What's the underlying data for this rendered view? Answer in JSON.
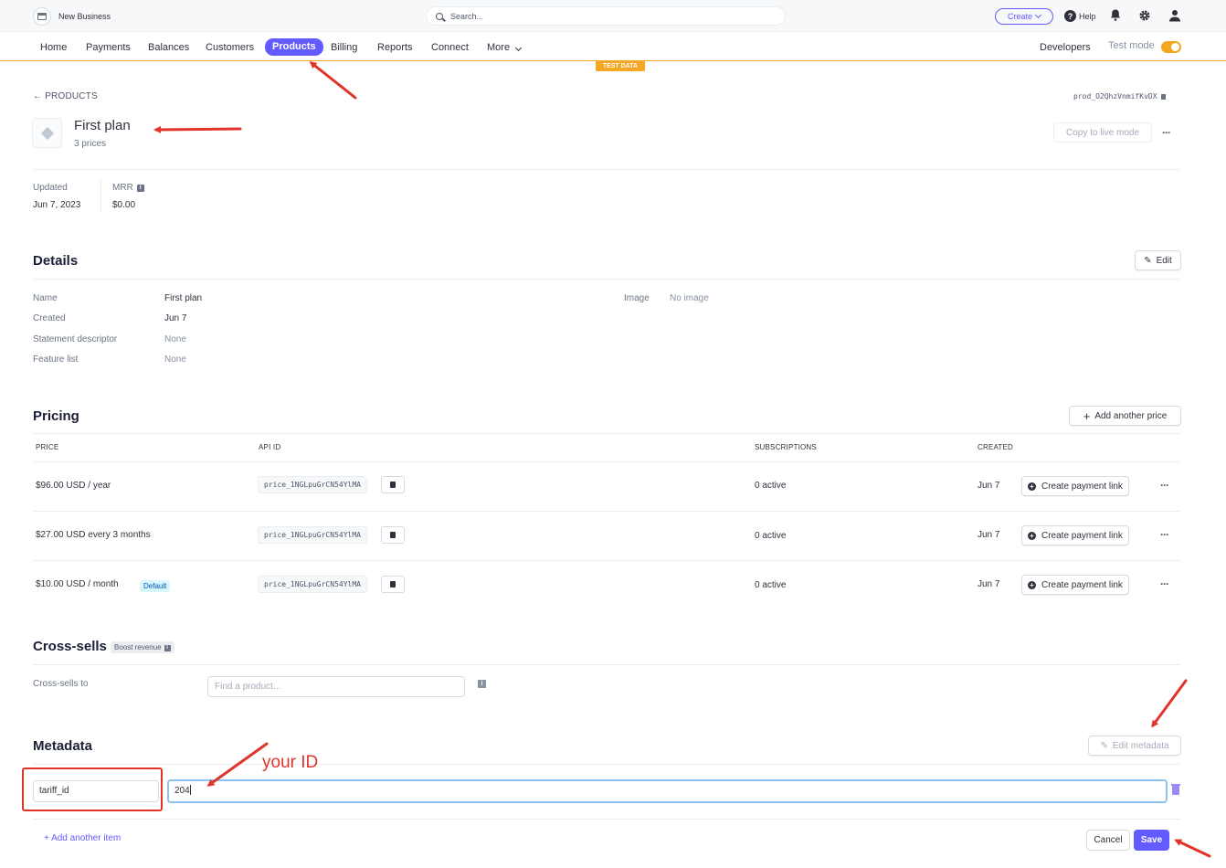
{
  "topbar": {
    "business_name": "New Business",
    "search_placeholder": "Search...",
    "create_label": "Create",
    "help_label": "Help"
  },
  "nav": {
    "items": [
      "Home",
      "Payments",
      "Balances",
      "Customers",
      "Products",
      "Billing",
      "Reports",
      "Connect",
      "More"
    ],
    "active": "Products",
    "developers_label": "Developers",
    "test_mode_label": "Test mode",
    "test_mode_on": true,
    "test_data_banner": "TEST DATA"
  },
  "header": {
    "back_label": "PRODUCTS",
    "product_id": "prod_O2QhzVnmifKvDX",
    "title": "First plan",
    "subtitle": "3 prices",
    "copy_live_label": "Copy to live mode"
  },
  "summary": {
    "updated_label": "Updated",
    "updated_value": "Jun 7, 2023",
    "mrr_label": "MRR",
    "mrr_value": "$0.00"
  },
  "details": {
    "heading": "Details",
    "edit_label": "Edit",
    "name_label": "Name",
    "name_value": "First plan",
    "created_label": "Created",
    "created_value": "Jun 7",
    "descriptor_label": "Statement descriptor",
    "descriptor_value": "None",
    "feature_label": "Feature list",
    "feature_value": "None",
    "image_label": "Image",
    "image_value": "No image"
  },
  "pricing": {
    "heading": "Pricing",
    "add_price_label": "Add another price",
    "columns": {
      "price": "PRICE",
      "api": "API ID",
      "subs": "SUBSCRIPTIONS",
      "created": "CREATED"
    },
    "rows": [
      {
        "price": "$96.00 USD / year",
        "api_id": "price_1NGLpuGrCN54YlMA",
        "subs": "0 active",
        "created": "Jun 7",
        "link": "Create payment link"
      },
      {
        "price": "$27.00 USD every 3 months",
        "api_id": "price_1NGLpuGrCN54YlMA",
        "subs": "0 active",
        "created": "Jun 7",
        "link": "Create payment link"
      },
      {
        "price": "$10.00 USD / month",
        "api_id": "price_1NGLpuGrCN54YlMA",
        "subs": "0 active",
        "created": "Jun 7",
        "link": "Create payment link",
        "badge": "Default"
      }
    ]
  },
  "crosssells": {
    "heading": "Cross-sells",
    "badge": "Boost revenue",
    "label": "Cross-sells to",
    "placeholder": "Find a product..."
  },
  "metadata": {
    "heading": "Metadata",
    "edit_label": "Edit metadata",
    "key": "tariff_id",
    "value": "204",
    "add_item_label": "+ Add another item",
    "cancel_label": "Cancel",
    "save_label": "Save",
    "annotation": "your ID"
  },
  "colors": {
    "accent": "#635bff",
    "annotation": "#e0342a",
    "test_mode": "#f5a623"
  }
}
